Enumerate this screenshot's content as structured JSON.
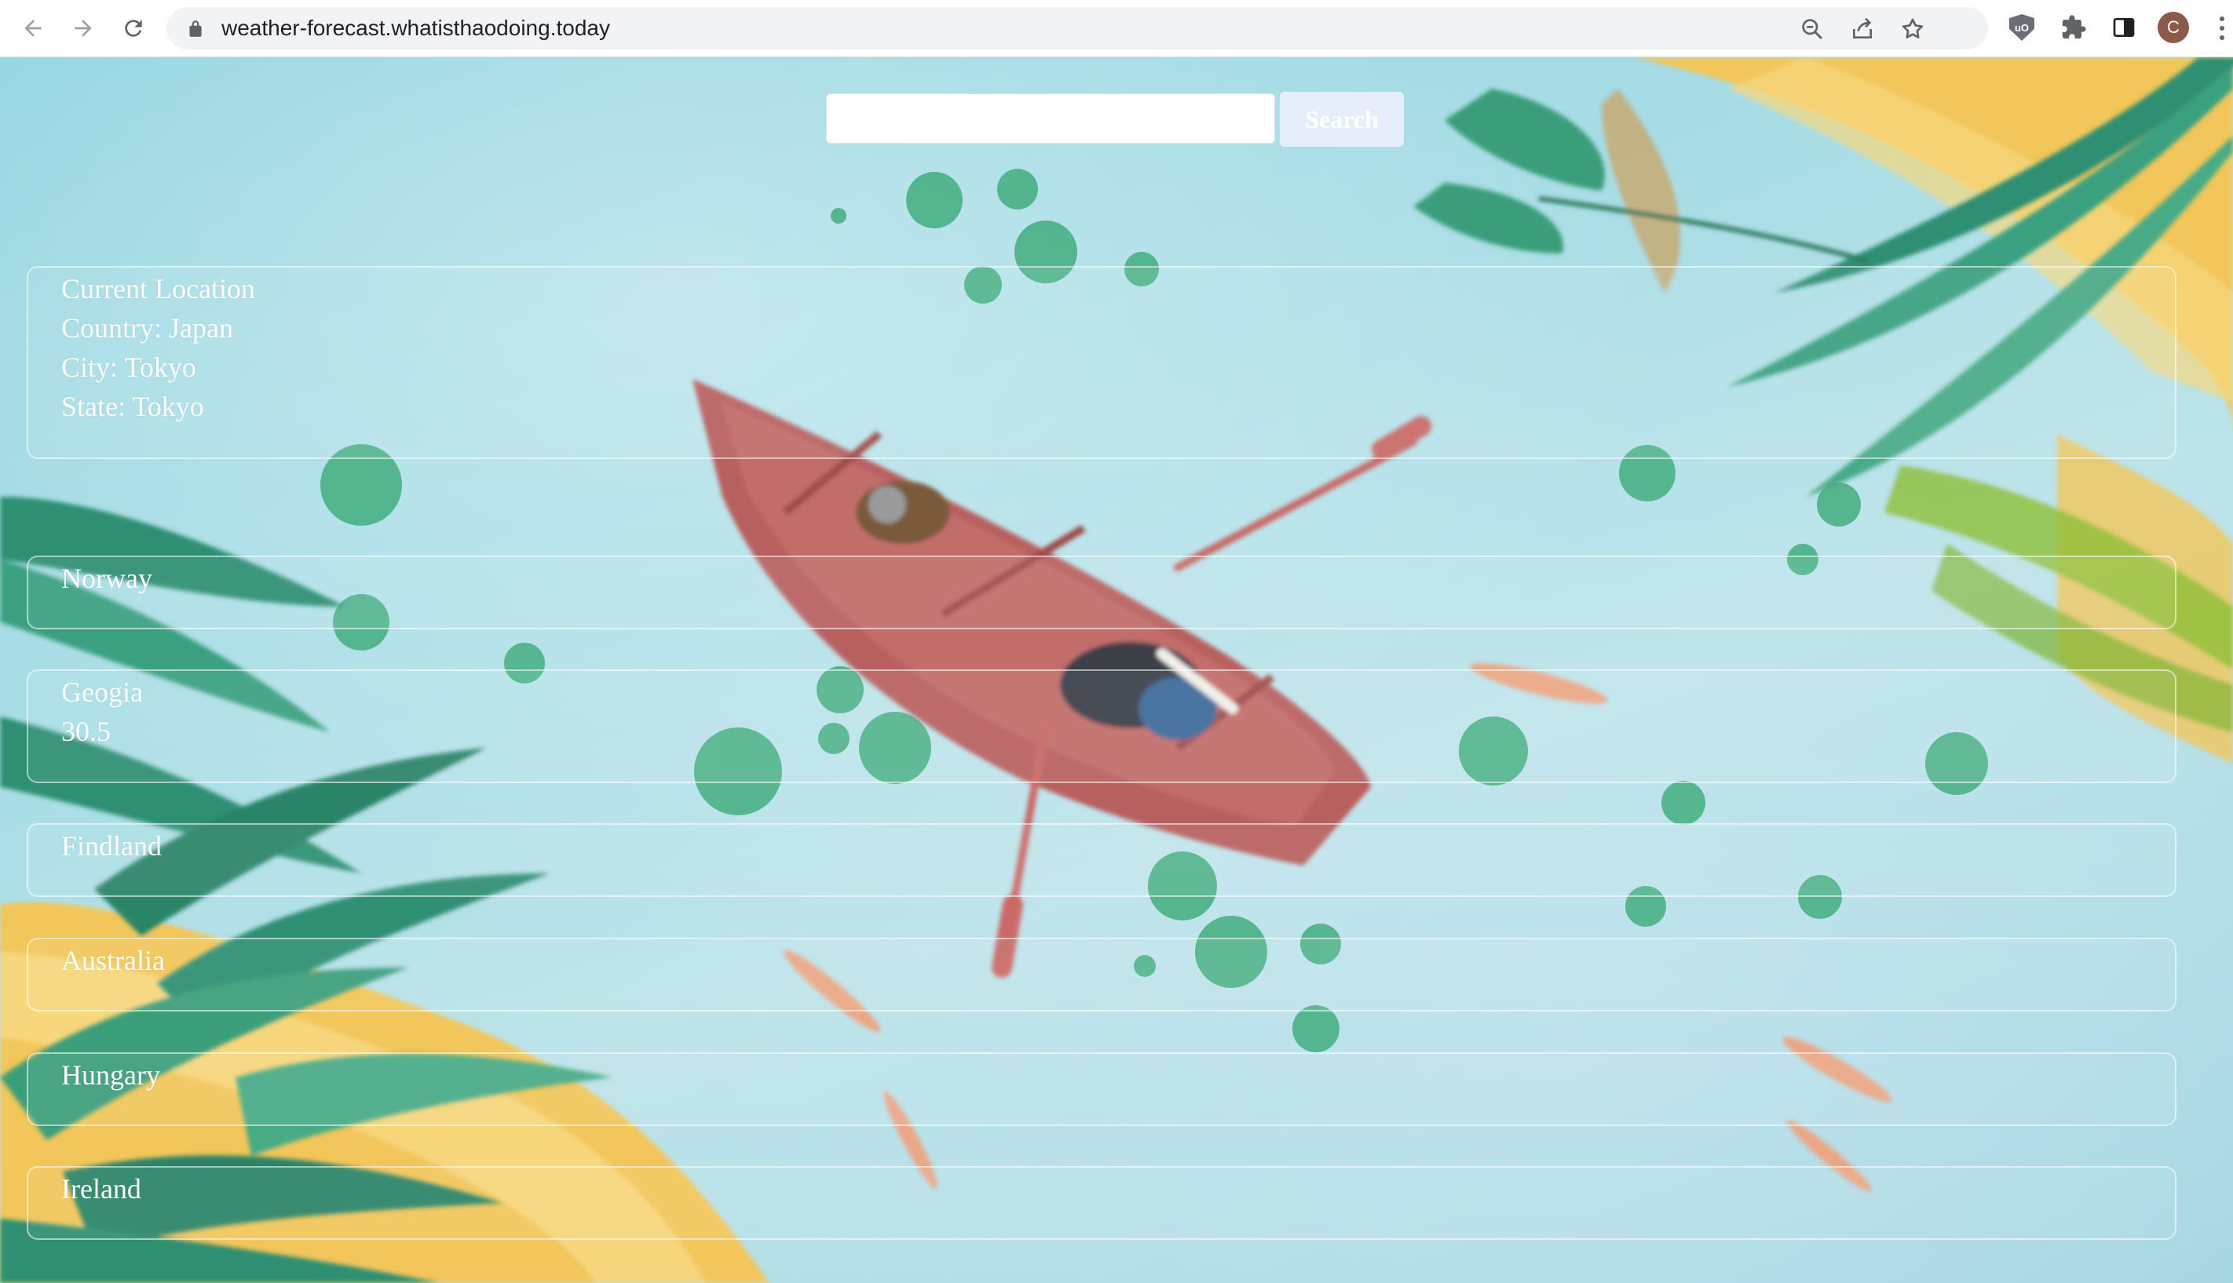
{
  "browser": {
    "url": "weather-forecast.whatisthaodoing.today",
    "profile_initial": "C",
    "icons": [
      "back-icon",
      "forward-icon",
      "reload-icon",
      "lock-icon",
      "zoom-icon",
      "share-icon",
      "bookmark-star-icon",
      "ublock-icon",
      "extensions-icon",
      "side-panel-icon",
      "menu-icon"
    ]
  },
  "search": {
    "value": "",
    "button_label": "Search"
  },
  "current_location": {
    "heading": "Current Location",
    "country": "Country: Japan",
    "city": "City: Tokyo",
    "state": "State: Tokyo"
  },
  "countries": [
    {
      "name": "Norway",
      "value": ""
    },
    {
      "name": "Geogia",
      "value": "30.5"
    },
    {
      "name": "Findland",
      "value": ""
    },
    {
      "name": "Australia",
      "value": ""
    },
    {
      "name": "Hungary",
      "value": ""
    },
    {
      "name": "Ireland",
      "value": ""
    }
  ],
  "colors": {
    "water": "#a8dde6",
    "boat": "#b8605e",
    "leaf_green": "#3a9e7a",
    "leaf_yellow": "#f2c65a",
    "card_border": "#ffffff"
  }
}
